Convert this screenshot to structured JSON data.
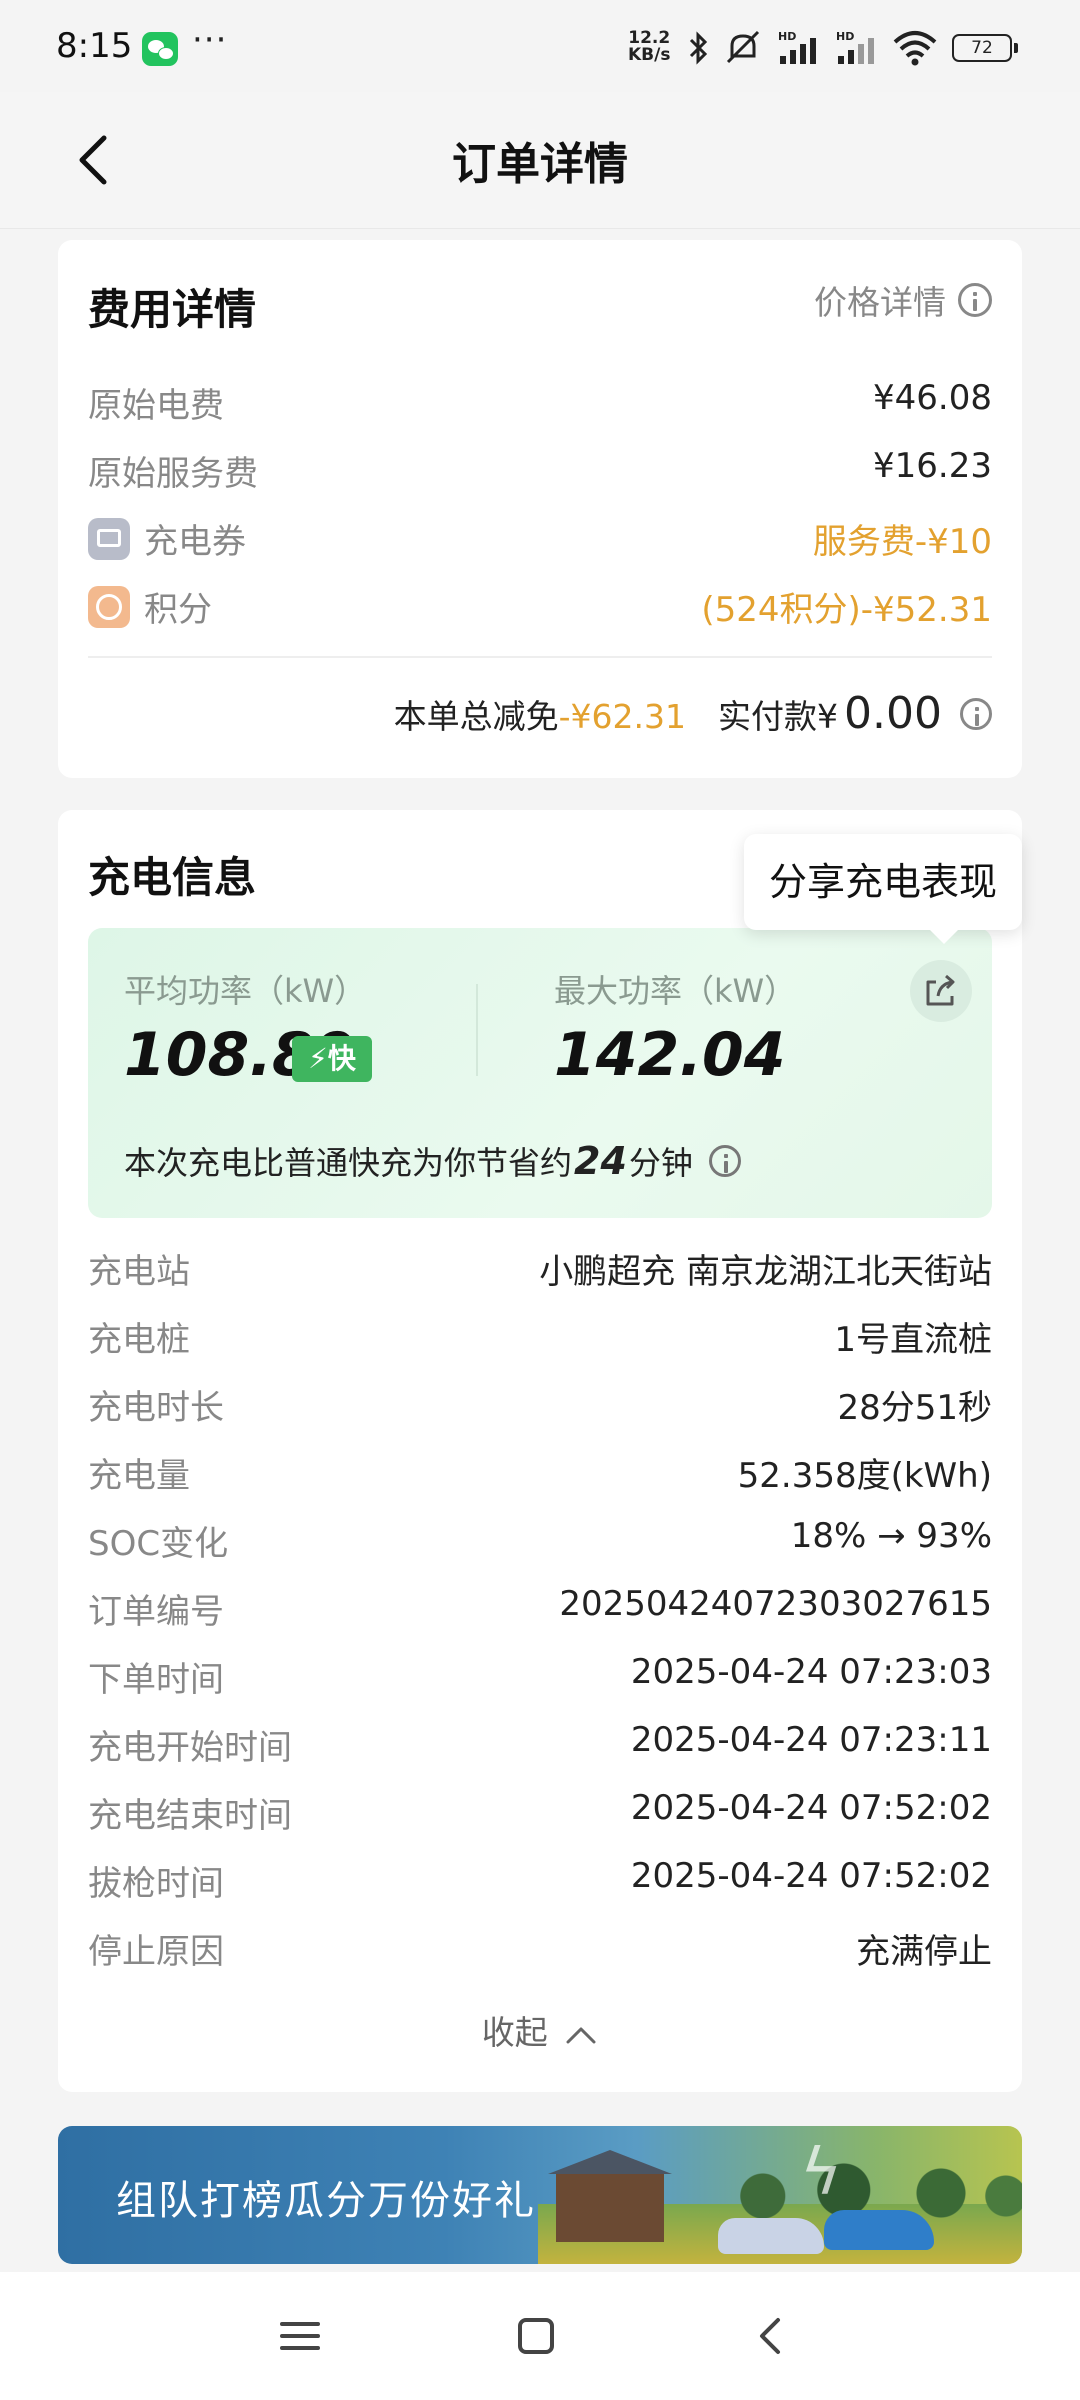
{
  "status_bar": {
    "time": "8:15",
    "speed_value": "12.2",
    "speed_unit": "KB/s",
    "battery": "72",
    "icons": [
      "wechat-icon",
      "bluetooth-icon",
      "mute-icon",
      "hd-signal-icon",
      "hd-signal-icon",
      "wifi-icon",
      "battery-icon"
    ]
  },
  "header": {
    "title": "订单详情"
  },
  "fee": {
    "title": "费用详情",
    "price_detail_label": "价格详情",
    "rows": [
      {
        "label": "原始电费",
        "value": "¥46.08"
      },
      {
        "label": "原始服务费",
        "value": "¥16.23"
      },
      {
        "label": "充电券",
        "value": "服务费-¥10"
      },
      {
        "label": "积分",
        "value": "(524积分)-¥52.31"
      }
    ],
    "total_discount_label": "本单总减免",
    "total_discount_value": "-¥62.31",
    "paid_label": "实付款¥",
    "paid_value": "0.00"
  },
  "charging": {
    "title": "充电信息",
    "share_tooltip": "分享充电表现",
    "avg_power_label": "平均功率（kW）",
    "avg_power_value": "108.89",
    "fast_badge": "快",
    "max_power_label": "最大功率（kW）",
    "max_power_value": "142.04",
    "note_prefix": "本次充电比普通快充为你节省约",
    "note_minutes": "24",
    "note_suffix": "分钟",
    "rows": [
      {
        "label": "充电站",
        "value": "小鹏超充 南京龙湖江北天街站"
      },
      {
        "label": "充电桩",
        "value": "1号直流桩"
      },
      {
        "label": "充电时长",
        "value": "28分51秒"
      },
      {
        "label": "充电量",
        "value": "52.358度(kWh)"
      },
      {
        "label": "SOC变化",
        "value": "18% → 93%"
      },
      {
        "label": "订单编号",
        "value": "2025042407230302761​5"
      },
      {
        "label": "下单时间",
        "value": "2025-04-24 07:23:03"
      },
      {
        "label": "充电开始时间",
        "value": "2025-04-24 07:23:11"
      },
      {
        "label": "充电结束时间",
        "value": "2025-04-24 07:52:02"
      },
      {
        "label": "拔枪时间",
        "value": "2025-04-24 07:52:02"
      },
      {
        "label": "停止原因",
        "value": "充满停止"
      }
    ],
    "collapse_label": "收起"
  },
  "banner": {
    "text": "组队打榜瓜分万份好礼"
  },
  "colors": {
    "accent_orange": "#e3a12f",
    "fast_green": "#3fb55f",
    "panel_green": "#def6e7"
  }
}
